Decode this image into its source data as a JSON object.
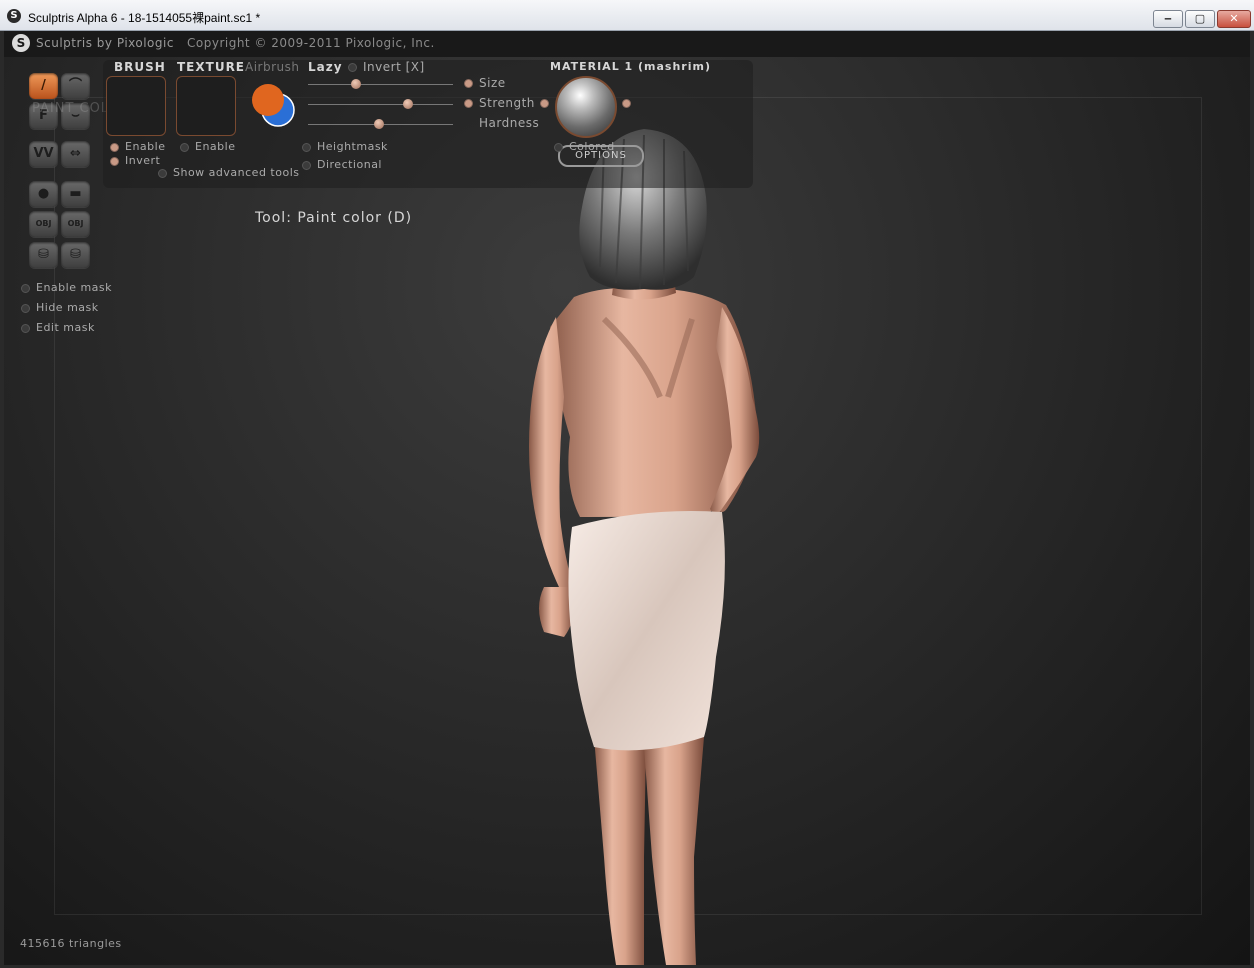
{
  "window": {
    "title": "Sculptris Alpha 6 - 18-1514055裸paint.sc1 *",
    "icon": "sculptris-logo-icon",
    "buttons": {
      "minimize": "‒",
      "maximize": "▢",
      "close": "✕"
    }
  },
  "appbar": {
    "app_name": "Sculptris by Pixologic",
    "copyright": "Copyright © 2009-2011 Pixologic, Inc."
  },
  "tools": {
    "buttons": [
      {
        "name": "paint-brush-icon",
        "glyph": "/",
        "active": true
      },
      {
        "name": "bump-icon",
        "glyph": "⌒",
        "active": false
      },
      {
        "name": "flatten-icon",
        "glyph": "F",
        "active": false
      },
      {
        "name": "bump-dip-icon",
        "glyph": "⌣",
        "active": false
      },
      {
        "name": "crease-icon",
        "glyph": "VV",
        "active": false
      },
      {
        "name": "symmetry-icon",
        "glyph": "⇔",
        "active": false
      },
      {
        "name": "sphere-icon",
        "glyph": "●",
        "active": false
      },
      {
        "name": "half-sphere-icon",
        "glyph": "▬",
        "active": false
      },
      {
        "name": "import-obj-icon",
        "glyph": "OBJ",
        "active": false
      },
      {
        "name": "export-obj-icon",
        "glyph": "OBJ",
        "active": false
      },
      {
        "name": "save-icon",
        "glyph": "⛁",
        "active": false
      },
      {
        "name": "save-as-icon",
        "glyph": "⛁",
        "active": false
      }
    ],
    "mask_options": [
      "Enable mask",
      "Hide mask",
      "Edit mask"
    ]
  },
  "ghost_label": "PAINT COLOR [D]",
  "brush": {
    "label": "BRUSH",
    "enable": "Enable",
    "invert": "Invert"
  },
  "texture": {
    "label": "TEXTURE",
    "enable": "Enable"
  },
  "airbrush": "Airbrush",
  "show_advanced": "Show advanced tools",
  "color": {
    "primary": "#e0661f",
    "secondary": "#2a6fd6"
  },
  "lazy": {
    "label": "Lazy",
    "invert": "Invert [X]",
    "heightmask": "Heightmask",
    "directional": "Directional"
  },
  "sliders": [
    {
      "label": "Size",
      "value": 0.33
    },
    {
      "label": "Strength",
      "value": 0.69
    },
    {
      "label": "Hardness",
      "value": 0.49
    }
  ],
  "options_button": "OPTIONS",
  "material": {
    "label": "MATERIAL 1 (mashrim)",
    "colored": "Colored"
  },
  "tool_status": "Tool: Paint color (D)",
  "footer": {
    "triangles": "415616 triangles"
  }
}
